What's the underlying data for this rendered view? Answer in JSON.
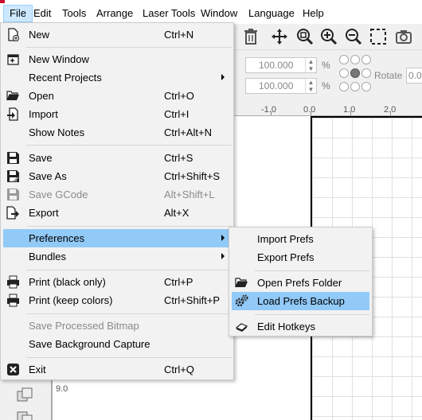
{
  "menubar": {
    "items": [
      {
        "label": "File",
        "active": true
      },
      {
        "label": "Edit"
      },
      {
        "label": "Tools"
      },
      {
        "label": "Arrange"
      },
      {
        "label": "Laser Tools"
      },
      {
        "label": "Window"
      },
      {
        "label": "Language"
      },
      {
        "label": "Help"
      }
    ]
  },
  "file_menu": {
    "new": {
      "label": "New",
      "shortcut": "Ctrl+N",
      "icon": "new-file-icon"
    },
    "new_window": {
      "label": "New Window",
      "icon": "new-window-icon"
    },
    "recent_projects": {
      "label": "Recent Projects",
      "submenu": true
    },
    "open": {
      "label": "Open",
      "shortcut": "Ctrl+O",
      "icon": "folder-open-icon"
    },
    "import": {
      "label": "Import",
      "shortcut": "Ctrl+I",
      "icon": "import-icon"
    },
    "show_notes": {
      "label": "Show Notes",
      "shortcut": "Ctrl+Alt+N"
    },
    "save": {
      "label": "Save",
      "shortcut": "Ctrl+S",
      "icon": "save-icon"
    },
    "save_as": {
      "label": "Save As",
      "shortcut": "Ctrl+Shift+S",
      "icon": "save-as-icon"
    },
    "save_gcode": {
      "label": "Save GCode",
      "shortcut": "Alt+Shift+L",
      "icon": "save-gcode-icon",
      "disabled": true
    },
    "export": {
      "label": "Export",
      "shortcut": "Alt+X",
      "icon": "export-icon"
    },
    "preferences": {
      "label": "Preferences",
      "submenu": true,
      "highlighted": true
    },
    "bundles": {
      "label": "Bundles",
      "submenu": true
    },
    "print_black": {
      "label": "Print (black only)",
      "shortcut": "Ctrl+P",
      "icon": "printer-icon"
    },
    "print_color": {
      "label": "Print (keep colors)",
      "shortcut": "Ctrl+Shift+P",
      "icon": "printer-icon"
    },
    "save_processed_bitmap": {
      "label": "Save Processed Bitmap",
      "disabled": true
    },
    "save_background_capture": {
      "label": "Save Background Capture"
    },
    "exit": {
      "label": "Exit",
      "shortcut": "Ctrl+Q",
      "icon": "exit-icon"
    }
  },
  "prefs_submenu": {
    "import_prefs": {
      "label": "Import Prefs"
    },
    "export_prefs": {
      "label": "Export Prefs"
    },
    "open_prefs_folder": {
      "label": "Open Prefs Folder",
      "icon": "folder-open-icon"
    },
    "load_prefs_backup": {
      "label": "Load Prefs Backup",
      "icon": "gears-icon",
      "highlighted": true
    },
    "edit_hotkeys": {
      "label": "Edit Hotkeys",
      "icon": "keyboard-icon"
    }
  },
  "properties": {
    "width_scale": "100.000",
    "height_scale": "100.000",
    "percent_symbol": "%",
    "rotate_label": "Rotate",
    "rotate_value": "0.0"
  },
  "ruler": {
    "labels": [
      "-1.0",
      "0.0",
      "1.0",
      "2.0"
    ]
  },
  "canvas": {
    "y_label": "9.0"
  },
  "colors": {
    "highlight": "#91c9f7",
    "menubar_active": "#cce8ff",
    "menu_bg": "#f2f2f2",
    "disabled_text": "#8a8a8a"
  }
}
